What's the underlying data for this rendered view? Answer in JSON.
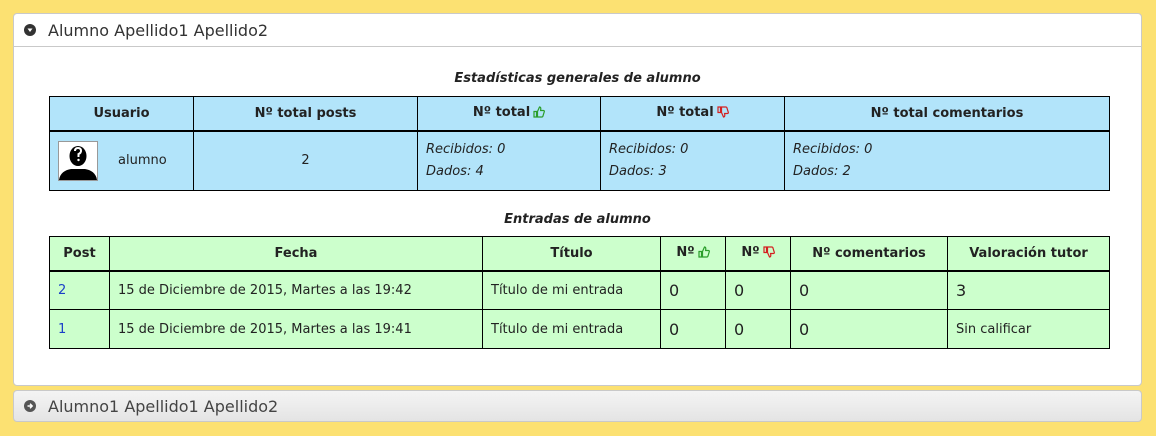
{
  "panels": [
    {
      "title": "Alumno Apellido1 Apellido2"
    },
    {
      "title": "Alumno1 Apellido1 Apellido2"
    }
  ],
  "stats": {
    "caption": "Estadísticas generales de alumno",
    "headers": {
      "usuario": "Usuario",
      "posts": "Nº total posts",
      "likes": "Nº total",
      "dislikes": "Nº total",
      "comments": "Nº total comentarios"
    },
    "row": {
      "username": "alumno",
      "posts": "2",
      "likes_recibidos": "Recibidos: 0",
      "likes_dados": "Dados: 4",
      "dislikes_recibidos": "Recibidos: 0",
      "dislikes_dados": "Dados: 3",
      "comments_recibidos": "Recibidos: 0",
      "comments_dados": "Dados: 2"
    }
  },
  "entries": {
    "caption": "Entradas de alumno",
    "headers": {
      "post": "Post",
      "fecha": "Fecha",
      "titulo": "Título",
      "likes": "Nº",
      "dislikes": "Nº",
      "comentarios": "Nº comentarios",
      "valoracion": "Valoración tutor"
    },
    "rows": [
      {
        "post": "2",
        "fecha": "15 de Diciembre de 2015, Martes a las 19:42",
        "titulo": "Título de mi entrada",
        "likes": "0",
        "dislikes": "0",
        "comentarios": "0",
        "valoracion": "3"
      },
      {
        "post": "1",
        "fecha": "15 de Diciembre de 2015, Martes a las 19:41",
        "titulo": "Título de mi entrada",
        "likes": "0",
        "dislikes": "0",
        "comentarios": "0",
        "valoracion": "Sin calificar"
      }
    ]
  },
  "colors": {
    "background": "#fce172",
    "stats_table": "#b2e4fa",
    "entries_table": "#ccffcc",
    "thumb_up": "#2a9d2a",
    "thumb_down": "#d42020"
  }
}
